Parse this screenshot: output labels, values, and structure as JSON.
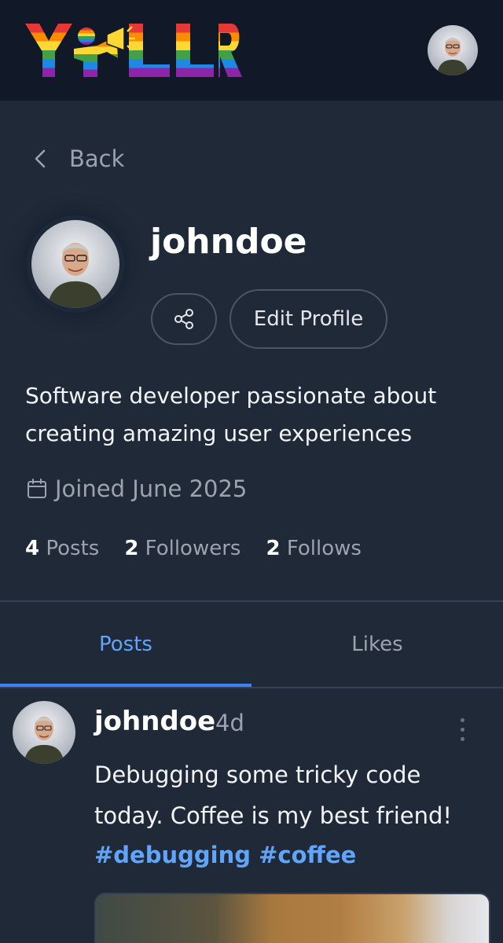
{
  "app": {
    "logo_text": "YELLR"
  },
  "nav": {
    "back_label": "Back"
  },
  "profile": {
    "username": "johndoe",
    "edit_label": "Edit Profile",
    "bio": "Software developer passionate about creating amazing user experiences",
    "joined": "Joined June 2025",
    "stats": [
      {
        "count": "4",
        "label": "Posts"
      },
      {
        "count": "2",
        "label": "Followers"
      },
      {
        "count": "2",
        "label": "Follows"
      }
    ]
  },
  "tabs": [
    {
      "label": "Posts",
      "active": true
    },
    {
      "label": "Likes",
      "active": false
    }
  ],
  "post": {
    "author": "johndoe",
    "time": "4d",
    "text": "Debugging some tricky code today. Coffee is my best friend!",
    "hashtags": [
      "#debugging",
      "#coffee"
    ]
  },
  "colors": {
    "background": "#1f2937",
    "header": "#111827",
    "accent": "#3b82f6",
    "link": "#60a5fa",
    "muted": "#9ca3af"
  },
  "icons": [
    "rainbow-logo",
    "avatar-photo",
    "chevron-left-icon",
    "share-icon",
    "calendar-icon",
    "more-vertical-icon"
  ]
}
